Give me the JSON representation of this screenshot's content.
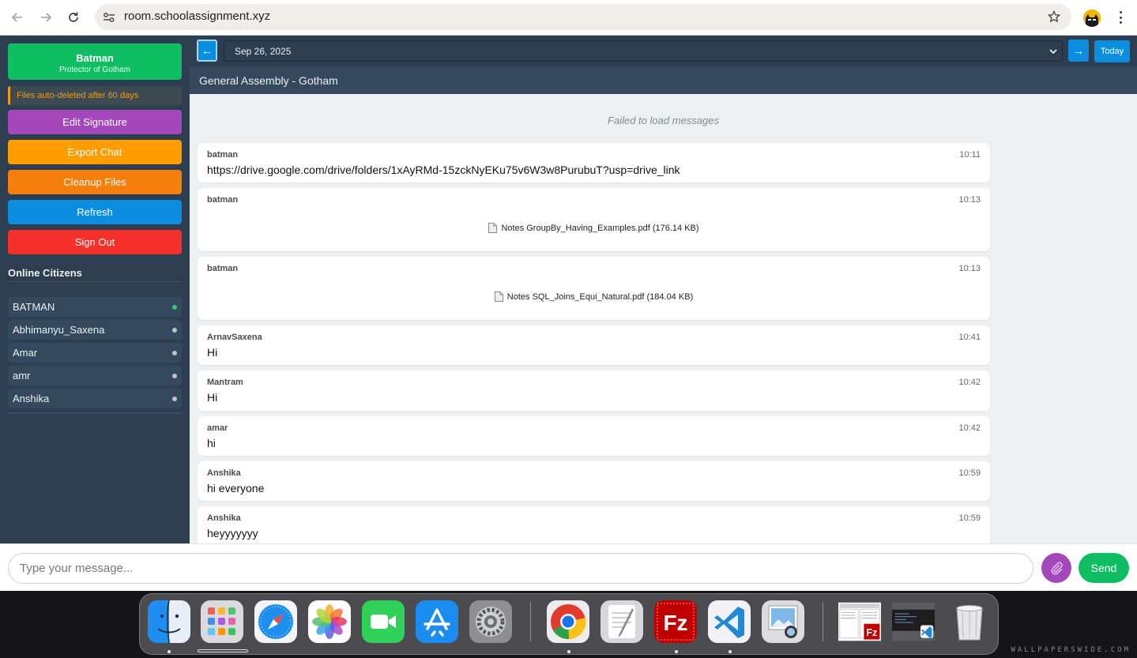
{
  "browser": {
    "url": "room.schoolassignment.xyz"
  },
  "sidebar": {
    "profile_name": "Batman",
    "profile_subtitle": "Protector of Gotham",
    "notice": "Files auto-deleted after 60 days",
    "buttons": {
      "edit_signature": "Edit Signature",
      "export_chat": "Export Chat",
      "cleanup_files": "Cleanup Files",
      "refresh": "Refresh",
      "sign_out": "Sign Out"
    },
    "button_colors": {
      "edit_signature": "#a347ba",
      "export_chat": "#ff9d00",
      "cleanup_files": "#f57e0d",
      "refresh": "#0b8ee0",
      "sign_out": "#f5302a"
    },
    "online_title": "Online Citizens",
    "users": [
      {
        "name": "BATMAN",
        "online": true
      },
      {
        "name": "Abhimanyu_Saxena",
        "online": false
      },
      {
        "name": "Amar",
        "online": false
      },
      {
        "name": "amr",
        "online": false
      },
      {
        "name": "Anshika",
        "online": false
      }
    ]
  },
  "date_bar": {
    "prev_label": "←",
    "selected_date": "Sep 26, 2025",
    "next_label": "→",
    "today_label": "Today"
  },
  "room": {
    "title": "General Assembly - Gotham",
    "status": "Failed to load messages"
  },
  "messages": [
    {
      "user": "batman",
      "time": "10:11",
      "text": "https://drive.google.com/drive/folders/1xAyRMd-15zckNyEKu75v6W3w8PurubuT?usp=drive_link"
    },
    {
      "user": "batman",
      "time": "10:13",
      "file": "Notes GroupBy_Having_Examples.pdf (176.14 KB)"
    },
    {
      "user": "batman",
      "time": "10:13",
      "file": "Notes SQL_Joins_Equi_Natural.pdf (184.04 KB)"
    },
    {
      "user": "ArnavSaxena",
      "time": "10:41",
      "text": "Hi"
    },
    {
      "user": "Mantram",
      "time": "10:42",
      "text": "Hi"
    },
    {
      "user": "amar",
      "time": "10:42",
      "text": "hi"
    },
    {
      "user": "Anshika",
      "time": "10:59",
      "text": "hi everyone"
    },
    {
      "user": "Anshika",
      "time": "10:59",
      "text": "heyyyyyyy"
    }
  ],
  "composer": {
    "placeholder": "Type your message...",
    "send_label": "Send"
  },
  "desktop": {
    "watermark": "WALLPAPERSWIDE.COM"
  },
  "dock": {
    "apps": [
      "finder-icon",
      "launchpad-icon",
      "safari-icon",
      "photos-icon",
      "facetime-icon",
      "app-store-icon",
      "system-settings-icon",
      "chrome-icon",
      "textedit-icon",
      "filezilla-icon",
      "vscode-icon",
      "preview-icon",
      "filezilla-window-thumbnail",
      "vscode-window-thumbnail",
      "trash-icon"
    ]
  }
}
